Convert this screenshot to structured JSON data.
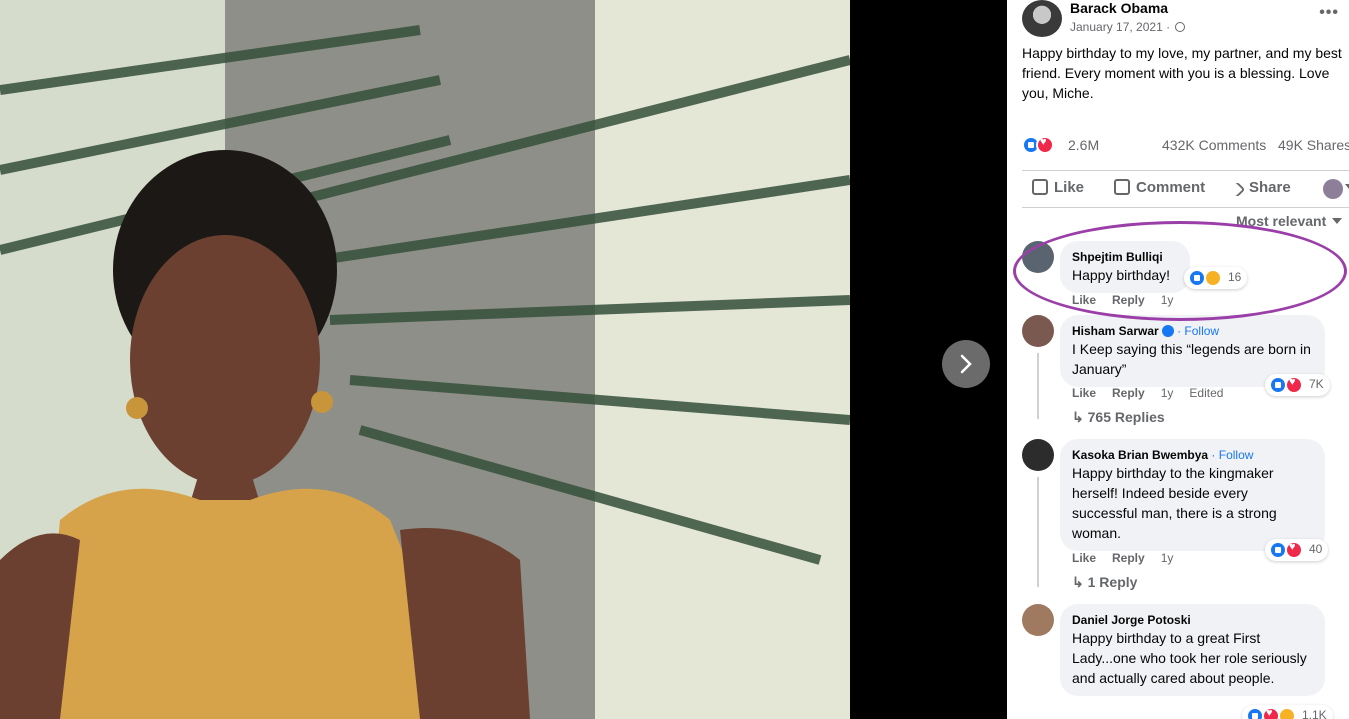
{
  "post": {
    "author": "Barack Obama",
    "date": "January 17, 2021 ·",
    "text": "Happy birthday to my love, my partner, and my best friend. Every moment with you is a blessing. Love you, Miche.",
    "reaction_count": "2.6M",
    "comment_count": "432K Comments",
    "share_count": "49K Shares"
  },
  "actions": {
    "like": "Like",
    "comment": "Comment",
    "share": "Share"
  },
  "sort_label": "Most relevant",
  "comments": [
    {
      "name": "Shpejtim Bulliqi",
      "follow": "",
      "text": "Happy birthday!",
      "react_count": "16",
      "like": "Like",
      "reply": "Reply",
      "time": "1y",
      "edited": "",
      "replies": ""
    },
    {
      "name": "Hisham Sarwar",
      "follow": "· Follow",
      "text": "I Keep saying this “legends are born in January”",
      "react_count": "7K",
      "like": "Like",
      "reply": "Reply",
      "time": "1y",
      "edited": "Edited",
      "replies": "765 Replies"
    },
    {
      "name": "Kasoka Brian Bwembya",
      "follow": "· Follow",
      "text": "Happy birthday to the kingmaker herself! Indeed beside every successful man, there is a strong woman.",
      "react_count": "40",
      "like": "Like",
      "reply": "Reply",
      "time": "1y",
      "edited": "",
      "replies": "1 Reply"
    },
    {
      "name": "Daniel Jorge Potoski",
      "follow": "",
      "text": "Happy birthday to a great First Lady...one who took her role seriously and actually cared about people.",
      "react_count": "1.1K",
      "like": "",
      "reply": "",
      "time": "",
      "edited": "",
      "replies": ""
    }
  ],
  "colors": {
    "accent": "#1877f2",
    "highlight": "#9b3fa8",
    "bubble": "#f0f2f5"
  },
  "icons": [
    "globe-icon",
    "more-icon",
    "like-icon",
    "comment-icon",
    "share-icon",
    "chevron-right-icon",
    "verified-icon"
  ]
}
